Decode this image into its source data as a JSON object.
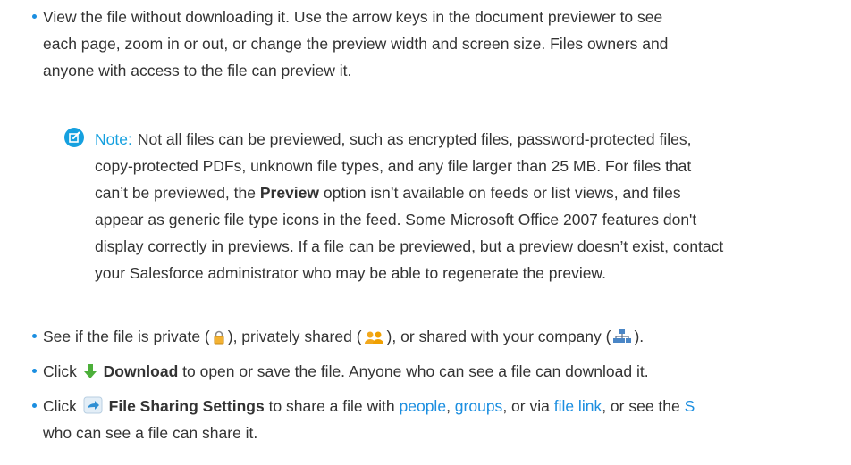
{
  "colors": {
    "accent": "#1b8ee0",
    "note": "#15a0df",
    "text": "#333333"
  },
  "bullet1": {
    "line1": "View the file without downloading it. Use the arrow keys in the document previewer to see",
    "line2": "each page, zoom in or out, or change the preview width and screen size. Files owners and",
    "line3": "anyone with access to the file can preview it."
  },
  "note": {
    "icon": "edit-note-icon",
    "label": "Note:",
    "line1": "Not all files can be previewed, such as encrypted files, password-protected files,",
    "line2": "copy-protected PDFs, unknown file types, and any file larger than 25 MB. For files that",
    "line3_pre": "can’t be previewed, the ",
    "line3_bold": "Preview",
    "line3_post": " option isn’t available on feeds or list views, and files",
    "line4": "appear as generic file type icons in the feed. Some Microsoft Office 2007 features don't",
    "line5": "display correctly in previews. If a file can be previewed, but a preview doesn’t exist, contact",
    "line6": "your Salesforce administrator who may be able to regenerate the preview."
  },
  "bullet2": {
    "t1": "See if the file is private (",
    "t2": "), privately shared (",
    "t3": "), or shared with your company (",
    "t4": ").",
    "icons": [
      "lock-icon",
      "people-icon",
      "company-network-icon"
    ]
  },
  "bullet3": {
    "pre": "Click ",
    "bold": "Download",
    "post": " to open or save the file. Anyone who can see a file can download it.",
    "icon": "download-arrow-icon"
  },
  "bullet4": {
    "pre": "Click ",
    "bold": "File Sharing Settings",
    "mid1": " to share a file with ",
    "link1": "people",
    "sep1": ", ",
    "link2": "groups",
    "mid2": ", or via ",
    "link3": "file link",
    "mid3": ", or see the ",
    "link4": "S",
    "line2": "who can see a file can share it.",
    "icon": "share-arrow-icon"
  }
}
